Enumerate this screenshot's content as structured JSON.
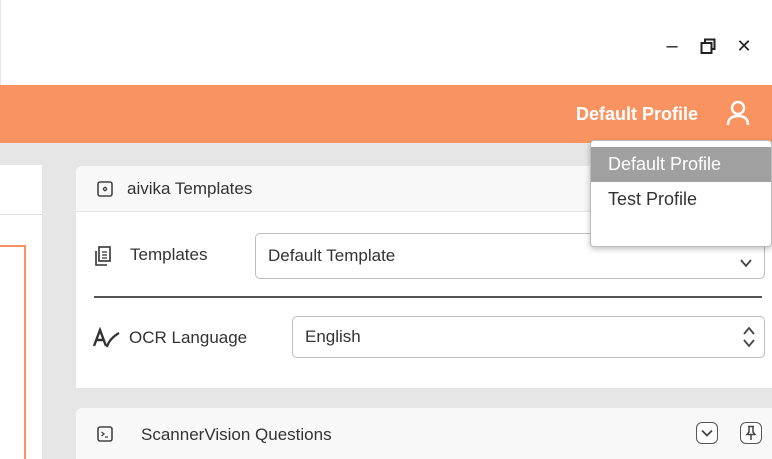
{
  "window": {
    "minimize_glyph": "–",
    "restore_icon": "restore-icon",
    "close_glyph": "✕"
  },
  "header": {
    "profile_name": "Default Profile",
    "profile_icon": "user-icon",
    "accent_color": "#f99462"
  },
  "profile_menu": {
    "items": [
      {
        "label": "Default Profile",
        "active": true
      },
      {
        "label": "Test Profile",
        "active": false
      }
    ]
  },
  "templates_panel": {
    "title": "aivika Templates",
    "title_icon": "template-panel-icon",
    "templates_label": "Templates",
    "templates_icon": "templates-icon",
    "template_value": "Default Template",
    "ocr_label": "OCR Language",
    "ocr_icon": "ocr-icon",
    "ocr_value": "English"
  },
  "questions_panel": {
    "title": "ScannerVision Questions",
    "title_icon": "terminal-icon",
    "collapse_icon": "chevron-down-icon",
    "pin_icon": "pin-icon"
  }
}
